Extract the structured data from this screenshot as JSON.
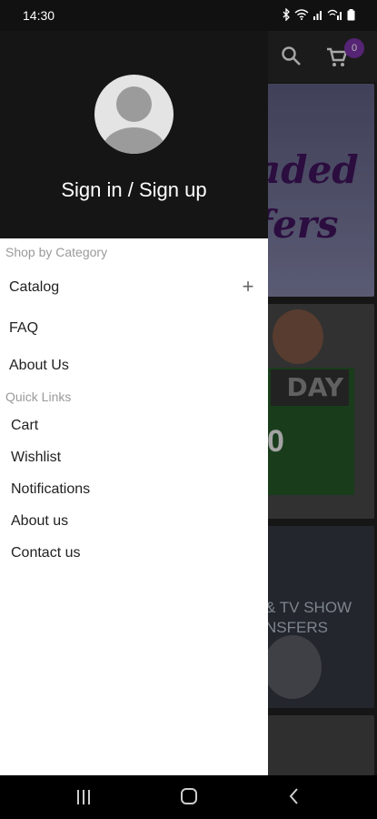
{
  "status_bar": {
    "time": "14:30"
  },
  "app": {
    "cart_count": "0",
    "banners": {
      "banner1_line1": "aded",
      "banner1_line2": "fers",
      "banner2_day": "DAY",
      "banner2_num": "0",
      "banner3_line1": "& TV SHOW",
      "banner3_line2": "NSFERS"
    }
  },
  "drawer": {
    "signin_label": "Sign in / Sign up",
    "shop_by_category_title": "Shop by Category",
    "category_items": [
      {
        "label": "Catalog"
      },
      {
        "label": "FAQ"
      },
      {
        "label": "About Us"
      }
    ],
    "quick_links_title": "Quick Links",
    "quick_links": [
      {
        "label": "Cart"
      },
      {
        "label": "Wishlist"
      },
      {
        "label": "Notifications"
      },
      {
        "label": "About us"
      },
      {
        "label": "Contact us"
      }
    ]
  },
  "colors": {
    "accent": "#6a2c8e",
    "drawer_header": "#151515",
    "section_title": "#9a9a9a"
  },
  "icons": [
    "search-icon",
    "cart-icon",
    "plus-icon",
    "avatar-icon",
    "recent-apps-icon",
    "home-icon",
    "back-icon"
  ]
}
